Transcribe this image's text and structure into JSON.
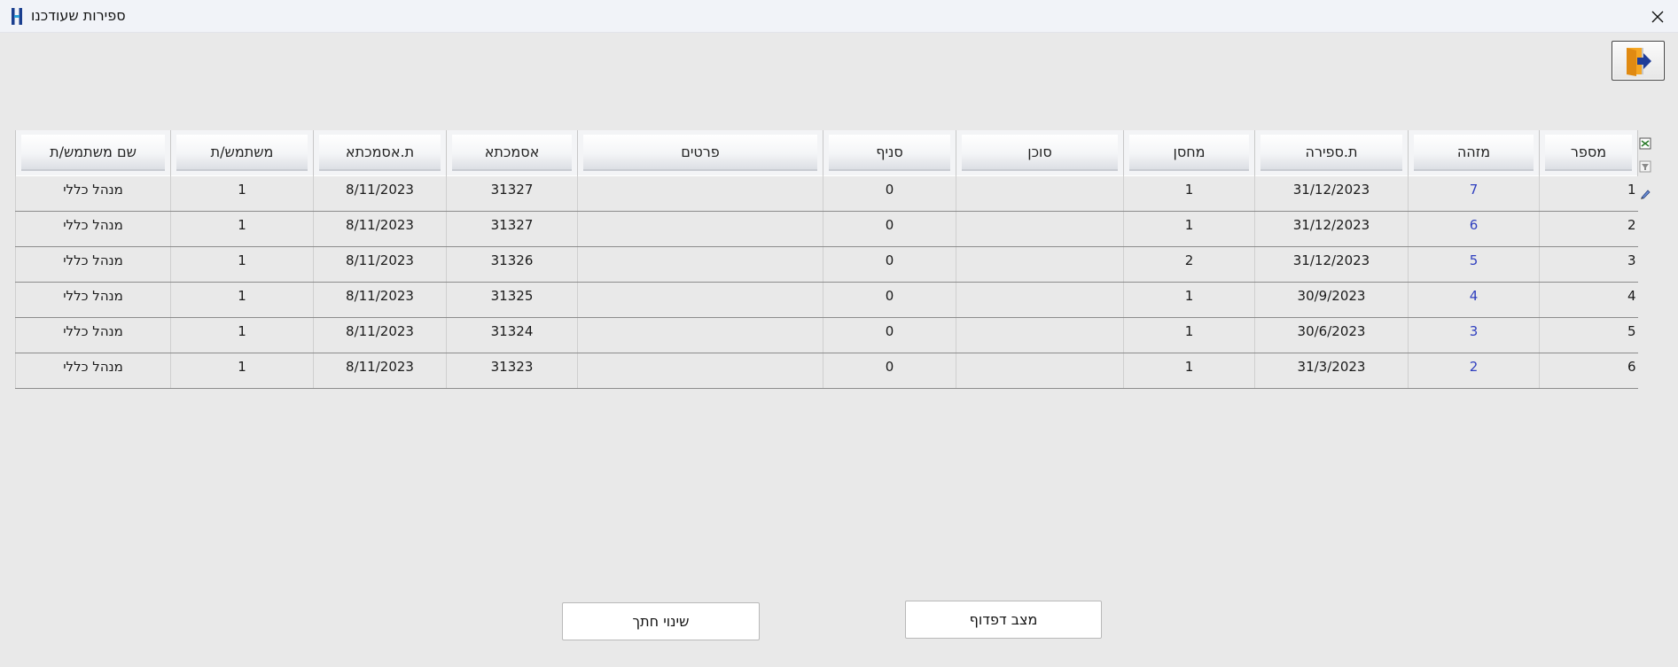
{
  "window": {
    "title": "ספירות שעודכנו",
    "app_icon": "h-logo-icon",
    "close_icon": "close-icon"
  },
  "toolbar": {
    "exit_icon": "exit-door-icon"
  },
  "table": {
    "columns": [
      "מספר",
      "מזהה",
      "ת.ספירה",
      "מחסן",
      "סוכן",
      "סניף",
      "פרטים",
      "אסמכתא",
      "ת.אסמכתא",
      "משתמש/ת",
      "שם משתמש/ת"
    ],
    "rows": [
      [
        "1",
        "7",
        "31/12/2023",
        "1",
        "",
        "0",
        "",
        "31327",
        "8/11/2023",
        "1",
        "מנהל כללי"
      ],
      [
        "2",
        "6",
        "31/12/2023",
        "1",
        "",
        "0",
        "",
        "31327",
        "8/11/2023",
        "1",
        "מנהל כללי"
      ],
      [
        "3",
        "5",
        "31/12/2023",
        "2",
        "",
        "0",
        "",
        "31326",
        "8/11/2023",
        "1",
        "מנהל כללי"
      ],
      [
        "4",
        "4",
        "30/9/2023",
        "1",
        "",
        "0",
        "",
        "31325",
        "8/11/2023",
        "1",
        "מנהל כללי"
      ],
      [
        "5",
        "3",
        "30/6/2023",
        "1",
        "",
        "0",
        "",
        "31324",
        "8/11/2023",
        "1",
        "מנהל כללי"
      ],
      [
        "6",
        "2",
        "31/3/2023",
        "1",
        "",
        "0",
        "",
        "31323",
        "8/11/2023",
        "1",
        "מנהל כללי"
      ]
    ],
    "link_color": "#2f3fbf"
  },
  "side_tools": [
    "export-excel-icon",
    "filter-icon",
    "edit-icon"
  ],
  "buttons": {
    "browse_mode": "מצב דפדוף",
    "change_section": "שינוי חתך"
  }
}
